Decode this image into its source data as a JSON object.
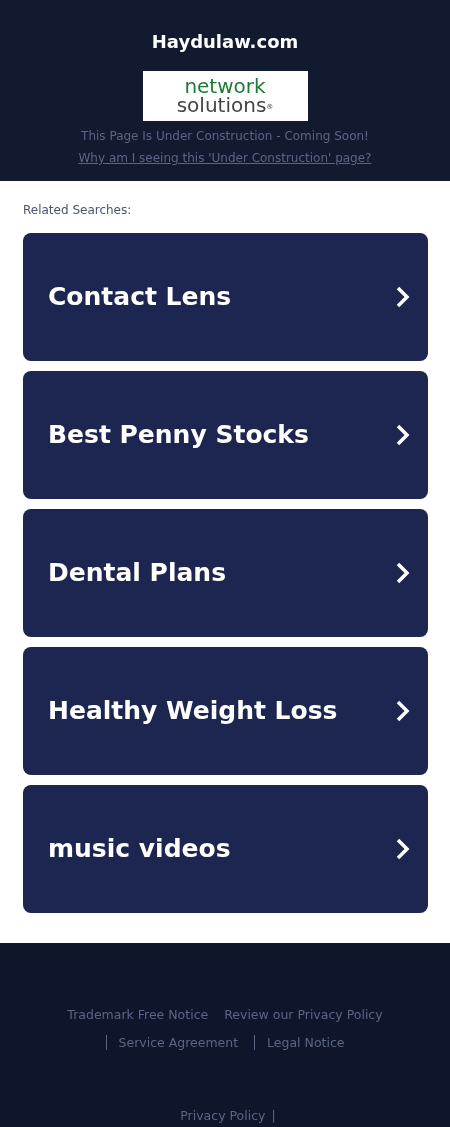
{
  "header": {
    "title": "Haydulaw.com",
    "logo": {
      "line_1": "network",
      "line_2": "solutions",
      "mark": "®"
    },
    "notice": "This Page Is Under Construction - Coming Soon!",
    "link": "Why am I seeing this 'Under Construction' page?"
  },
  "related": {
    "heading": "Related Searches:",
    "items": [
      {
        "label": "Contact Lens"
      },
      {
        "label": "Best Penny Stocks"
      },
      {
        "label": "Dental Plans"
      },
      {
        "label": "Healthy Weight Loss"
      },
      {
        "label": "music videos"
      }
    ]
  },
  "footer": {
    "links": [
      {
        "label": "Trademark Free Notice",
        "divider": false
      },
      {
        "label": "Review our Privacy Policy",
        "divider": false
      },
      {
        "label": "Service Agreement",
        "divider": true
      },
      {
        "label": "Legal Notice",
        "divider": true
      }
    ],
    "bottom": {
      "label": "Privacy Policy",
      "separator": "|"
    }
  }
}
